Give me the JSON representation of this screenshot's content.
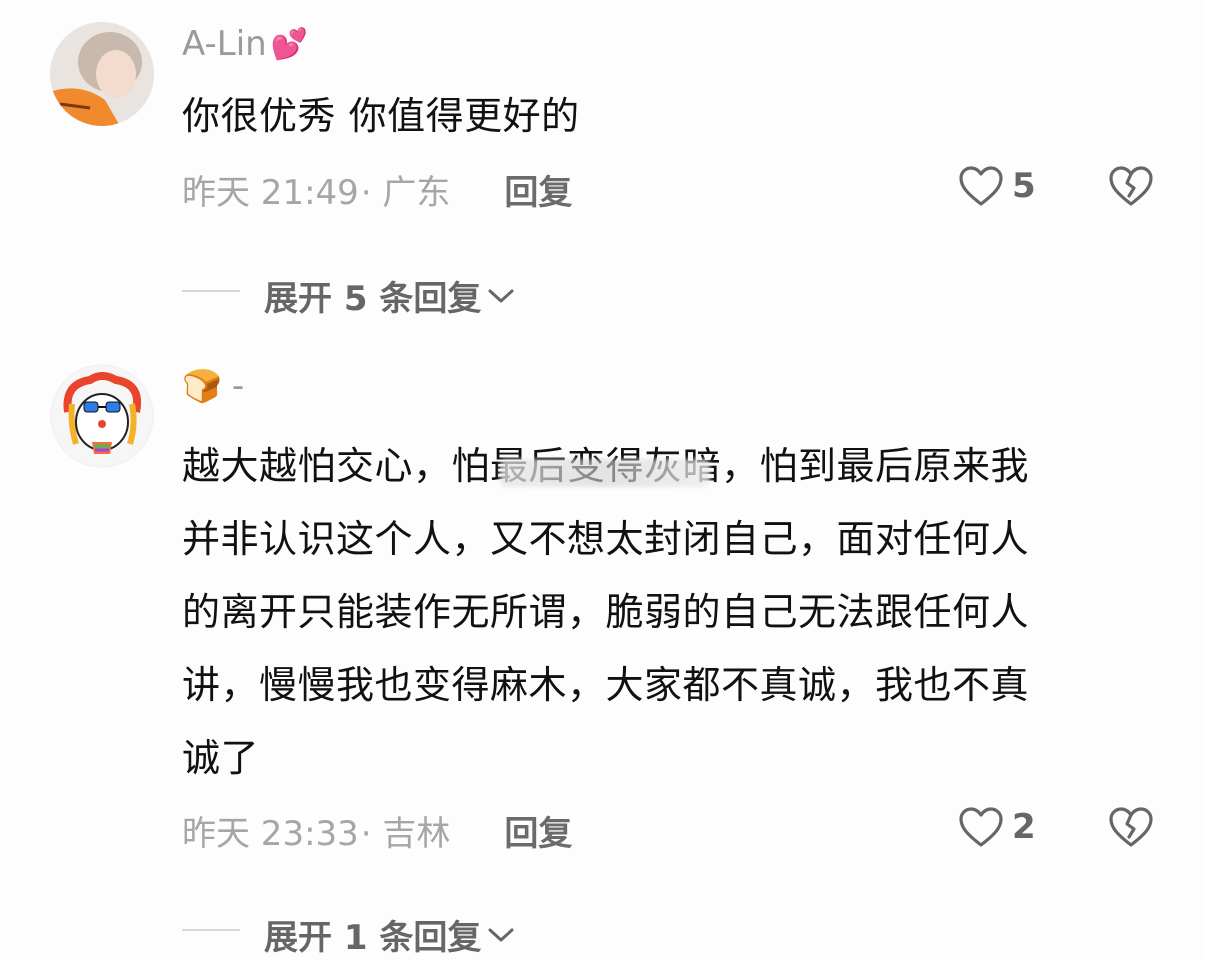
{
  "comments": [
    {
      "username": "A-Lin",
      "username_emoji": "💕",
      "text": "你很优秀 你值得更好的",
      "time": "昨天 21:49",
      "location": "· 广东",
      "reply_label": "回复",
      "likes": "5",
      "expand_label": "展开 5 条回复"
    },
    {
      "username": "-",
      "username_emoji": "🍞",
      "text_lines": [
        "越大越怕交心，怕最后变得灰暗，怕到最后原来我",
        "并非认识这个人，又不想太封闭自己，面对任何人",
        "的离开只能装作无所谓，脆弱的自己无法跟任何人",
        "讲，慢慢我也变得麻木，大家都不真诚，我也不真",
        "诚了"
      ],
      "time": "昨天 23:33",
      "location": "· 吉林",
      "reply_label": "回复",
      "likes": "2",
      "expand_label": "展开 1 条回复"
    }
  ],
  "colors": {
    "meta_gray": "#a6a6a6",
    "text_black": "#111111",
    "icon_gray": "#666666"
  }
}
